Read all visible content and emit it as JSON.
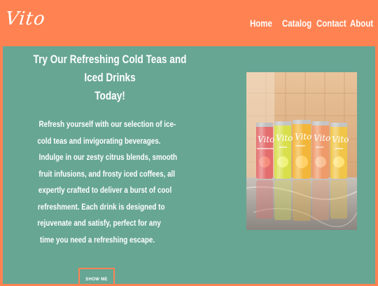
{
  "brand": {
    "logo_text": "Vito"
  },
  "nav": {
    "items": [
      {
        "label": "Home"
      },
      {
        "label": "Catalog"
      },
      {
        "label": "Contact"
      },
      {
        "label": "About"
      }
    ]
  },
  "hero": {
    "heading_lines": [
      "Try Our Refreshing Cold Teas and Iced Drinks",
      "Today!"
    ],
    "body_lines": [
      "Refresh yourself with our selection of ice-",
      "cold teas and invigorating beverages.",
      "Indulge in our zesty citrus blends, smooth",
      "fruit infusions, and frosty iced coffees, all",
      "expertly crafted to deliver a burst of cool",
      "refreshment. Each drink is designed to",
      "rejuvenate and satisfy, perfect for any",
      "time you need a refreshing escape."
    ],
    "button_label": "SHOW ME",
    "image": {
      "can_brand": "Vito",
      "can_labels": [
        "WATERMELON",
        "LEMON",
        "ORANGE",
        "PEACH",
        "LEMON"
      ]
    }
  },
  "colors": {
    "header_bg": "#ff8352",
    "main_bg": "#67a693",
    "text": "#ffffff",
    "button_border": "#ff8352"
  }
}
